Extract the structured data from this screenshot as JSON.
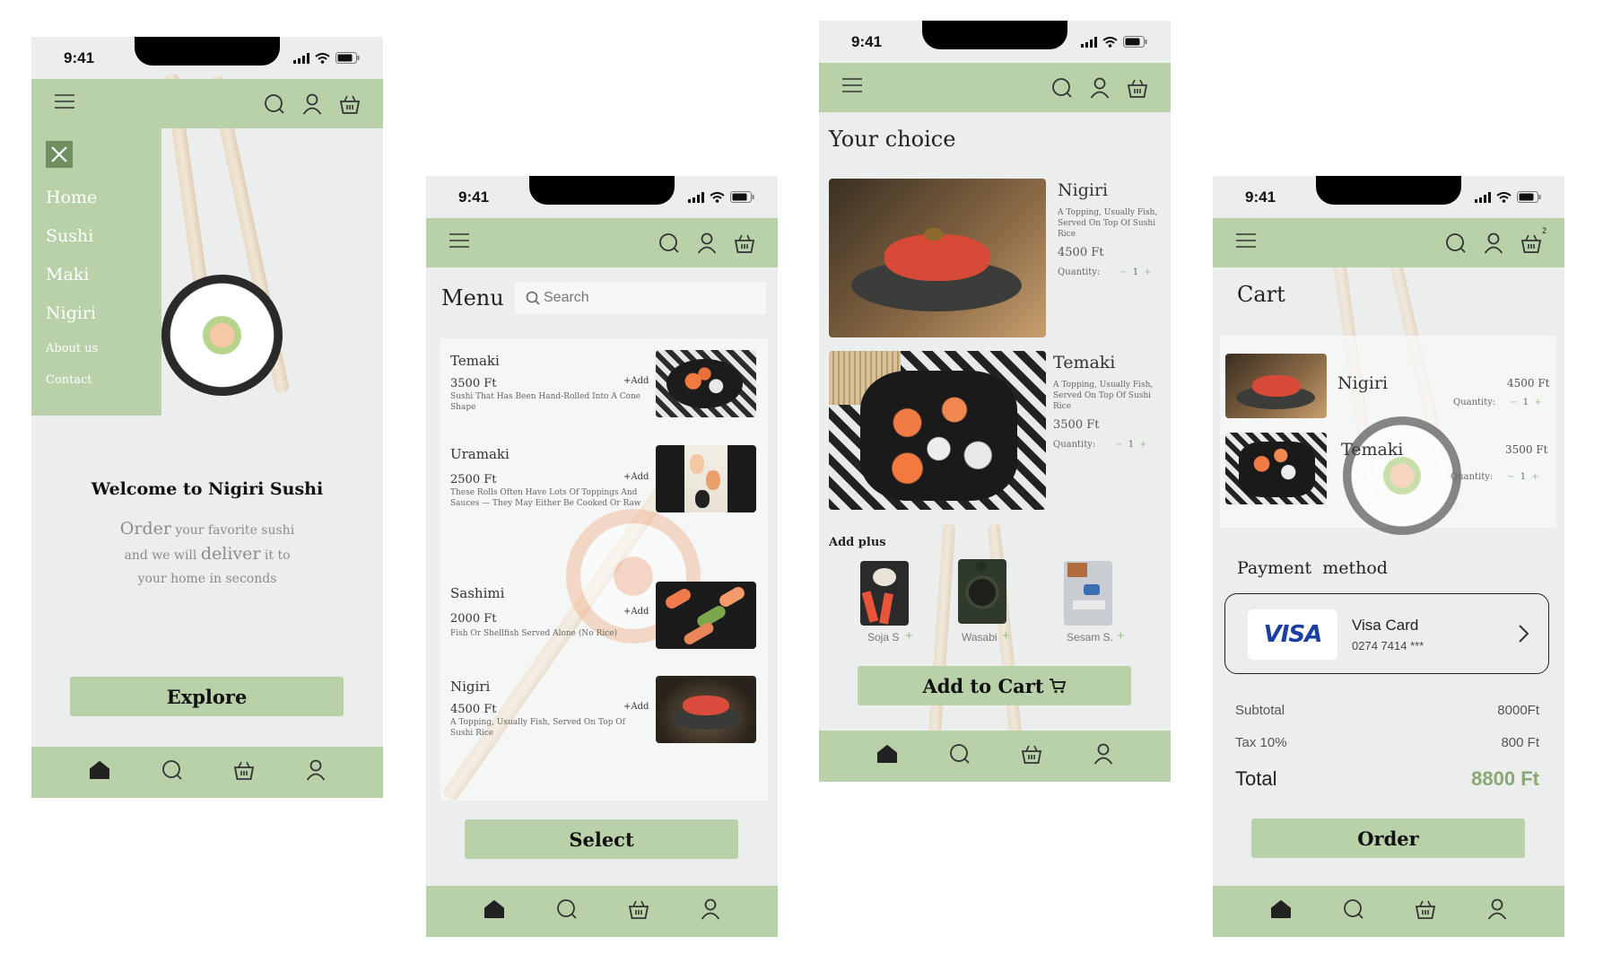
{
  "status": {
    "time": "9:41"
  },
  "phone1": {
    "menu_items": [
      "Home",
      "Sushi",
      "Maki",
      "Nigiri",
      "About us",
      "Contact"
    ],
    "welcome_title": "Welcome to Nigiri Sushi",
    "tagline_line1_big": "Order",
    "tagline_line1_rest": " your favorite sushi",
    "tagline_line2_a": "and we will ",
    "tagline_line2_big": "deliver",
    "tagline_line2_b": " it to",
    "tagline_line3": "your home in seconds",
    "explore_label": "Explore"
  },
  "phone2": {
    "title": "Menu",
    "search_placeholder": "Search",
    "add_label": "+Add",
    "items": [
      {
        "name": "Temaki",
        "price": "3500 Ft",
        "desc": "Sushi That Has Been Hand-Rolled Into A Cone Shape"
      },
      {
        "name": "Uramaki",
        "price": "2500 Ft",
        "desc": "These Rolls Often Have Lots Of Toppings And Sauces — They May Either Be Cooked Or Raw"
      },
      {
        "name": "Sashimi",
        "price": "2000 Ft",
        "desc": "Fish Or Shellfish Served Alone (No Rice)"
      },
      {
        "name": "Nigiri",
        "price": "4500 Ft",
        "desc": "A Topping, Usually Fish, Served On Top Of Sushi Rice"
      }
    ],
    "select_label": "Select"
  },
  "phone3": {
    "title": "Your choice",
    "quantity_label": "Quantity:",
    "items": [
      {
        "name": "Nigiri",
        "desc": "A Topping, Usually Fish, Served On Top Of Sushi Rice",
        "price": "4500 Ft",
        "qty": "1"
      },
      {
        "name": "Temaki",
        "desc": "A Topping, Usually Fish, Served On Top Of Sushi Rice",
        "price": "3500 Ft",
        "qty": "1"
      }
    ],
    "add_plus_title": "Add plus",
    "extras": [
      "Soja S",
      "Wasabi",
      "Sesam S."
    ],
    "add_to_cart_label": "Add to Cart"
  },
  "phone4": {
    "title": "Cart",
    "cart_badge": "2",
    "quantity_label": "Quantity:",
    "items": [
      {
        "name": "Nigiri",
        "price": "4500 Ft",
        "qty": "1"
      },
      {
        "name": "Temaki",
        "price": "3500 Ft",
        "qty": "1"
      }
    ],
    "payment_title": "Payment  method",
    "card_brand": "VISA",
    "card_name": "Visa Card",
    "card_number": "0274 7414 ***",
    "subtotal_label": "Subtotal",
    "subtotal_value": "8000Ft",
    "tax_label": "Tax 10%",
    "tax_value": "800 Ft",
    "total_label": "Total",
    "total_value": "8800 Ft",
    "order_label": "Order"
  },
  "colors": {
    "accent": "#b9d1a8",
    "accent_dark": "#6f8f60",
    "total_green": "#8aa876"
  },
  "icons": [
    "menu-icon",
    "search-icon",
    "user-icon",
    "basket-icon",
    "home-icon",
    "close-icon",
    "chevron-right-icon",
    "cart-icon"
  ]
}
